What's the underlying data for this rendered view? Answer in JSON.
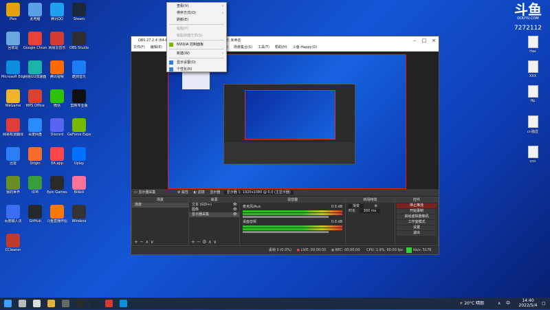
{
  "desktop_icons": [
    {
      "label": "Plex",
      "color": "#e5a00d"
    },
    {
      "label": "此电脑",
      "color": "#5aa0e6"
    },
    {
      "label": "腾讯QQ",
      "color": "#1fa0f0"
    },
    {
      "label": "Steam",
      "color": "#1b2838"
    },
    {
      "label": "回收站",
      "color": "#6aa7e0"
    },
    {
      "label": "Google Chrome",
      "color": "#e94235"
    },
    {
      "label": "网易云音乐",
      "color": "#d43c33"
    },
    {
      "label": "OBS Studio",
      "color": "#302e31"
    },
    {
      "label": "Microsoft Edge",
      "color": "#0c8de0"
    },
    {
      "label": "网易UU加速器",
      "color": "#1bb3a9"
    },
    {
      "label": "腾讯视频",
      "color": "#ff6a00"
    },
    {
      "label": "酷狗音乐",
      "color": "#1f7cf7"
    },
    {
      "label": "WeGame",
      "color": "#f0b429"
    },
    {
      "label": "WPS Office",
      "color": "#d7432c"
    },
    {
      "label": "微信",
      "color": "#2dc100"
    },
    {
      "label": "剪映专业版",
      "color": "#101010"
    },
    {
      "label": "网易有道翻译",
      "color": "#e23b3b"
    },
    {
      "label": "百度网盘",
      "color": "#2a8bff"
    },
    {
      "label": "Discord",
      "color": "#5865f2"
    },
    {
      "label": "GeForce Experience",
      "color": "#76b900"
    },
    {
      "label": "迅雷",
      "color": "#2b7cf5"
    },
    {
      "label": "Origin",
      "color": "#f56c2d"
    },
    {
      "label": "EA app",
      "color": "#ff4747"
    },
    {
      "label": "Uplay",
      "color": "#0070ff"
    },
    {
      "label": "我的世界",
      "color": "#6b8e23"
    },
    {
      "label": "IDM",
      "color": "#3a9d3a"
    },
    {
      "label": "Epic Games",
      "color": "#2a2a2a"
    },
    {
      "label": "Bilibili",
      "color": "#fb7299"
    },
    {
      "label": "百度输入法",
      "color": "#3a6df0"
    },
    {
      "label": "GitHub",
      "color": "#24292e"
    },
    {
      "label": "斗鱼直播伴侣",
      "color": "#ff7800"
    },
    {
      "label": "Wireless",
      "color": "#333333"
    },
    {
      "label": "CCleaner",
      "color": "#c0392b"
    }
  ],
  "right_icons": [
    {
      "label": "Has"
    },
    {
      "label": "XXX"
    },
    {
      "label": "ffp"
    },
    {
      "label": "cn独显"
    },
    {
      "label": "cnn"
    }
  ],
  "watermark": {
    "brand": "斗鱼",
    "site": "DOUYU.COM",
    "room": "7272112"
  },
  "context_menu": [
    {
      "label": "查看(V)",
      "submenu": true,
      "disabled": false
    },
    {
      "label": "排序方式(O)",
      "submenu": true,
      "disabled": false
    },
    {
      "label": "刷新(E)",
      "submenu": false,
      "disabled": false
    },
    {
      "sep": true
    },
    {
      "label": "粘贴(P)",
      "submenu": false,
      "disabled": true
    },
    {
      "label": "粘贴快捷方式(S)",
      "submenu": false,
      "disabled": true
    },
    {
      "sep": true
    },
    {
      "label": "NVIDIA 控制面板",
      "submenu": false,
      "disabled": false,
      "icon": "nvidia"
    },
    {
      "sep": true
    },
    {
      "label": "新建(W)",
      "submenu": true,
      "disabled": false
    },
    {
      "sep": true
    },
    {
      "label": "显示设置(D)",
      "submenu": false,
      "disabled": false,
      "icon": "display"
    },
    {
      "label": "个性化(R)",
      "submenu": false,
      "disabled": false,
      "icon": "personalize"
    }
  ],
  "obs": {
    "title": "OBS 27.2.4 (64-bit, windows) - 配置文件: 未命名 - 场景: 未命名",
    "menu": [
      "文件(F)",
      "编辑(E)",
      "视图(V)",
      "停靠部件(D)",
      "配置文件(P)",
      "场景集合(S)",
      "工具(T)",
      "帮助(H)",
      "斗鱼-Happy(D)"
    ],
    "source_toolbar": {
      "no_source": "显示器采集",
      "properties": "属性",
      "filters": "滤镜",
      "display_label": "显示器",
      "display_value": "显示器 1: 1920x1080 @ 0,0 (主显示器)"
    },
    "scenes": {
      "header": "场景",
      "items": [
        "场景"
      ]
    },
    "sources": {
      "header": "来源",
      "items": [
        "文本 (GDI+)",
        "图像",
        "显示器采集"
      ]
    },
    "mixer": {
      "header": "混音器",
      "channels": [
        {
          "name": "麦克风/Aux",
          "db": "0.0 dB"
        },
        {
          "name": "桌面音频",
          "db": "0.0 dB"
        }
      ]
    },
    "transitions": {
      "header": "转场特效",
      "type": "渐变",
      "duration_label": "时长",
      "duration": "300 ms"
    },
    "controls": {
      "header": "控件",
      "buttons": [
        "停止推流",
        "开始录制",
        "启动虚拟摄像机",
        "工作室模式",
        "设置",
        "退出"
      ]
    },
    "status": {
      "dropped": "丢帧 0 (0.0%)",
      "live": "LIVE: 00:00:03",
      "rec": "REC: 00:00:00",
      "cpu": "CPU: 1.9%, 60.00 fps",
      "kbps": "kb/s: 5176"
    }
  },
  "taskbar": {
    "weather": "20°C 晴朗",
    "time": "14:40",
    "date": "2022/5/4",
    "ime": "中"
  }
}
